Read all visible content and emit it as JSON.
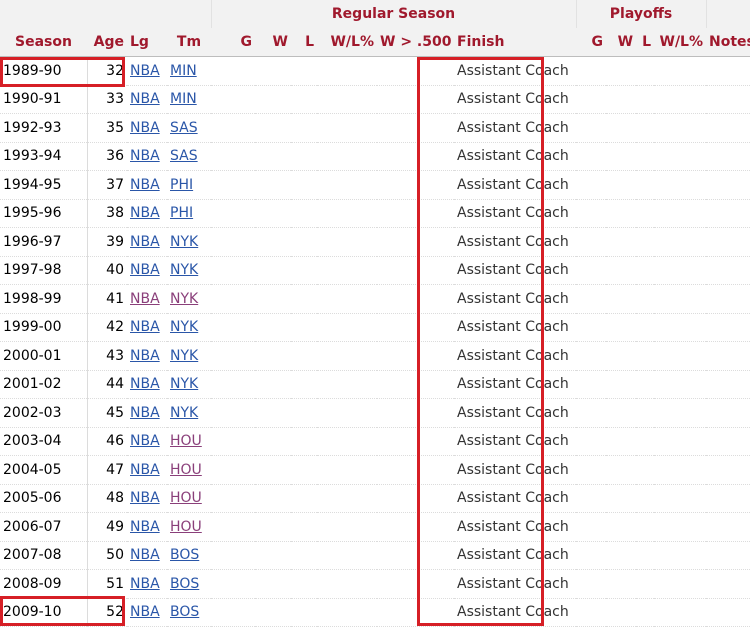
{
  "header": {
    "regular_season": "Regular Season",
    "playoffs": "Playoffs",
    "columns": [
      "Season",
      "Age",
      "Lg",
      "Tm",
      "G",
      "W",
      "L",
      "W/L%",
      "W > .500",
      "Finish",
      "G",
      "W",
      "L",
      "W/L%",
      "Notes"
    ]
  },
  "rows": [
    {
      "season": "1989-90",
      "age": "32",
      "lg": "NBA",
      "tm": "MIN",
      "finish": "Assistant Coach"
    },
    {
      "season": "1990-91",
      "age": "33",
      "lg": "NBA",
      "tm": "MIN",
      "finish": "Assistant Coach"
    },
    {
      "season": "1992-93",
      "age": "35",
      "lg": "NBA",
      "tm": "SAS",
      "finish": "Assistant Coach"
    },
    {
      "season": "1993-94",
      "age": "36",
      "lg": "NBA",
      "tm": "SAS",
      "finish": "Assistant Coach"
    },
    {
      "season": "1994-95",
      "age": "37",
      "lg": "NBA",
      "tm": "PHI",
      "finish": "Assistant Coach"
    },
    {
      "season": "1995-96",
      "age": "38",
      "lg": "NBA",
      "tm": "PHI",
      "finish": "Assistant Coach"
    },
    {
      "season": "1996-97",
      "age": "39",
      "lg": "NBA",
      "tm": "NYK",
      "finish": "Assistant Coach"
    },
    {
      "season": "1997-98",
      "age": "40",
      "lg": "NBA",
      "tm": "NYK",
      "finish": "Assistant Coach"
    },
    {
      "season": "1998-99",
      "age": "41",
      "lg": "NBA",
      "tm": "NYK",
      "finish": "Assistant Coach"
    },
    {
      "season": "1999-00",
      "age": "42",
      "lg": "NBA",
      "tm": "NYK",
      "finish": "Assistant Coach"
    },
    {
      "season": "2000-01",
      "age": "43",
      "lg": "NBA",
      "tm": "NYK",
      "finish": "Assistant Coach"
    },
    {
      "season": "2001-02",
      "age": "44",
      "lg": "NBA",
      "tm": "NYK",
      "finish": "Assistant Coach"
    },
    {
      "season": "2002-03",
      "age": "45",
      "lg": "NBA",
      "tm": "NYK",
      "finish": "Assistant Coach"
    },
    {
      "season": "2003-04",
      "age": "46",
      "lg": "NBA",
      "tm": "HOU",
      "finish": "Assistant Coach"
    },
    {
      "season": "2004-05",
      "age": "47",
      "lg": "NBA",
      "tm": "HOU",
      "finish": "Assistant Coach"
    },
    {
      "season": "2005-06",
      "age": "48",
      "lg": "NBA",
      "tm": "HOU",
      "finish": "Assistant Coach"
    },
    {
      "season": "2006-07",
      "age": "49",
      "lg": "NBA",
      "tm": "HOU",
      "finish": "Assistant Coach"
    },
    {
      "season": "2007-08",
      "age": "50",
      "lg": "NBA",
      "tm": "BOS",
      "finish": "Assistant Coach"
    },
    {
      "season": "2008-09",
      "age": "51",
      "lg": "NBA",
      "tm": "BOS",
      "finish": "Assistant Coach"
    },
    {
      "season": "2009-10",
      "age": "52",
      "lg": "NBA",
      "tm": "BOS",
      "finish": "Assistant Coach"
    }
  ],
  "colors": {
    "header_text": "#a0192d",
    "link": "#2a56a8",
    "visited_link": "#8a3f7a",
    "highlight_box": "#d61f26"
  }
}
